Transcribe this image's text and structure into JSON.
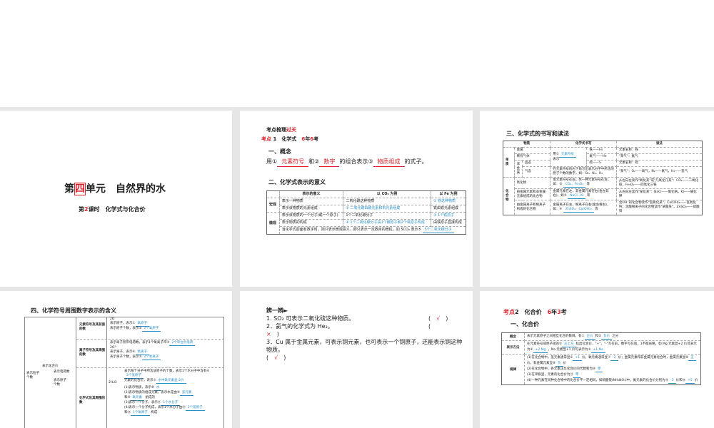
{
  "slide1": {
    "title_a": "第",
    "title_num": "四",
    "title_b": "单元　自然界的水",
    "sub_a": "第",
    "sub_num": "2",
    "sub_b": "课时　化学式与化合价"
  },
  "slide2": {
    "heading_a": "考点梳理",
    "heading_b": "过关",
    "kp_label": "考点",
    "kp_num": "1",
    "kp_title": "化学式",
    "kp_y": "6",
    "kp_nian": "年",
    "kp_k": "6",
    "kp_kao": "考",
    "sec1": "一、概念",
    "concept_a": "用①",
    "blank1": "元素符号",
    "concept_b": "和②",
    "blank2": "数字",
    "concept_c": "的组合表示③",
    "blank3": "物质组成",
    "concept_d": "的式子。",
    "sec2": "二、化学式表示的意义",
    "headers": [
      "",
      "表示的意义",
      "以 CO₂ 为例",
      "以 Fe 为例"
    ],
    "macro": "宏观",
    "micro": "微观",
    "rows": [
      [
        "表示一种物质",
        "二氧化碳这种物质",
        "① 铁这种物质"
      ],
      [
        "表示该物质的元素组成",
        "② 二氧化碳由碳元素和氧元素组成",
        "铁由铁元素组成"
      ],
      [
        "表示该物质的一个分子(或一个原子)",
        "1个二氧化碳分子",
        "③ 1个铁原子"
      ],
      [
        "表示物质的构成",
        "④ 1个二氧化碳分子由1个碳原子和2个氧原子构成",
        "由铁原子直接构成"
      ]
    ],
    "note": "当化学式前面有数字时，则只表示微观意义，即只表示一定数目的微粒。如 5CO₂ 表示⑤",
    "note_ans": "5个二氧化碳分子"
  },
  "slide3": {
    "sec": "三、化学式的书写和读法",
    "headers": [
      "物质",
      "化学式书写",
      "读法"
    ],
    "danzhi": "单质",
    "huahewu": "化合物",
    "feijinshu": "非金属",
    "r_metal": "金属",
    "r_noble": "稀有气体",
    "r_solid": "固态",
    "r_gas": "气态",
    "write_a": "用①",
    "write_ans": "元素符号",
    "write_b": "表示",
    "ex_fe": "铁——Fe",
    "ex_he": "氦气——He",
    "ex_s": "硫——S",
    "read_metal": "元素名称：铁",
    "read_noble": "\"某气\"：氦气",
    "read_solid": "元素名称：硫",
    "gas_write": "在元素符号的右下角写出表示分子中所含的原子个数的数字，如：O₂、N₂、H₂",
    "gas_read": "\"某气\"：O₂——氧气，N₂——氮气，H₂——氢气",
    "oxide": "氧化物",
    "oxide_write": "氧元素符号在右，另一种元素符号在左，如：②",
    "oxide_ans": "CO₂、Fe₃O₄",
    "deng": "等",
    "oxide_read": "从右向左读作\"氧化某\"或\"几氧化几某\"：CO₂——二氧化碳，Fe₃O₄——四氧化三铁",
    "mn": "由金属元素和非金属元素组成的化合物",
    "mn_write": "金属元素在左，非金属元素在右(金左非右)，如③",
    "mn_ans": "NaCl、KI",
    "mn_read": "从右向左读作\"某化某\"：NaCl——氯化钠，KI——碘化钾",
    "ion": "由金属离子和根离子构成的化合物",
    "ion_write": "金属离子在左，根离子在右(金左根右)，如：④",
    "ion_ans": "ZnSO₄、Ca(OH)₂",
    "ion_read": "含OH⁻的化合物读作\"氢氧化某\"，Ca(OH)₂——氢氧化钙；含酸根离子的化合物读作\"某酸某\"，ZnSO₄——硫酸锌"
  },
  "slide4": {
    "sec": "四、化学符号周围数字表示的含义",
    "left_a": "表示粒子个数",
    "left_b": "表示化合价",
    "left_c": "表示电荷数",
    "left_d": "表示原子个数",
    "c1": "元素符号及其前面的数",
    "c2": "离子符号及其周围的数",
    "c3": "化学式及其周围的数",
    "f1": "2O",
    "l1a": "表示原子，表示①",
    "l1a_ans": "氧原子",
    "l1b": "表示原子个数，表示②",
    "l1b_ans": "2个氧原子",
    "f2": "2O²⁻",
    "l2a": "表示离子所带电荷数，表示1个氧离子带③",
    "l2a_ans": "2个单位负电荷",
    "l2b": "表示离子，表示④",
    "l2b_ans": "氧离子",
    "l2c": "表示离子个数，表示⑤",
    "l2c_ans": "2个氧离子",
    "f3": "2H₂O",
    "l3a": "表示每个分子中所含该原子的个数，表示1个水分子中含有⑥",
    "l3a_ans": "2个氢原子",
    "l3b": "元素的化合价，表示⑦",
    "l3b_ans": "水中氧元素显-2价",
    "l3c": "(1)表示物质，表示⑧",
    "l3c_ans": "水",
    "l3d": "(2)表示物质的组成元素，表示水是由⑨",
    "l3d_ans": "氢元素",
    "l3e": "和⑩",
    "l3e_ans": "氧元素",
    "l3e2": "组成的",
    "l3f": "(3)表示一个分子，表示⑪",
    "l3f_ans": "1个水分子",
    "l3g": "(4)表示一个分子构成，表示1个水分子由⑫",
    "l3g_ans": "2个氢原子",
    "l3h": "和⑬",
    "l3h_ans": "1个氧原子",
    "l3h2": "构成"
  },
  "slide5": {
    "title": "辨一辨►",
    "q1": "1. SO₂ 可表示二氧化硫这种物质。",
    "a1": "√",
    "q2": "2．氦气的化学式为 He₂。",
    "a2": "×",
    "q3": "3．Cu 属于金属元素，可表示铜元素，也可表示一个铜原子，还能表示铜这种物质。",
    "a3": "√"
  },
  "slide6": {
    "kp_label": "考点",
    "kp_num": "2",
    "kp_title": "化合价",
    "kp_y": "6",
    "kp_nian": "年",
    "kp_k": "3",
    "kp_kao": "考",
    "sec": "一、化合价",
    "r1": "概念",
    "r1a": "表示元素原子之间相互化合的数目，有①",
    "r1_ans1": "正价",
    "r1b": "和②",
    "r1_ans2": "负价",
    "r1c": "之分",
    "r2": "表示方法",
    "r2a": "在元素符号或原子团的③",
    "r2_ans1": "正上方",
    "r2b": "标出化合价，\"+\"、\"-\"写在前，数字写在后，1不能省略。如 Mg 元素显+2 价可表示为④",
    "r2_ans2": "+2 Mg",
    "r2c": "，Na 元素显+1 价可表示为⑤",
    "r2_ans3": "+1 Na",
    "r3": "规律",
    "r3a": "(1)在化合物中，氢元素通常显⑥",
    "r3_ans1": "+1",
    "r3b": "价，氧元素通常显⑦",
    "r3_ans2": "-2",
    "r3c": "价；金属元素和非金属元素化合时，金属元素显⑧",
    "r3_ans3": "正",
    "r3d": "价，非金属元素显⑨",
    "r3_ans4": "负",
    "r3e": "价",
    "r3f": "(2)在化合物中，各元素正负化合价的代数和为⑩",
    "r3_ans5": "零",
    "r3g": "(3)在单质里，元素的化合价为⑪",
    "r3_ans6": "零",
    "r3h": "(4)一种元素在同种化合物中的化合价不一定相同，如硝酸铵(NH₄NO₃)中，氮元素的化合价分别为⑫",
    "r3_ans7": "-3",
    "r3i": "价和⑬",
    "r3_ans8": "+5",
    "r3j": "价"
  }
}
